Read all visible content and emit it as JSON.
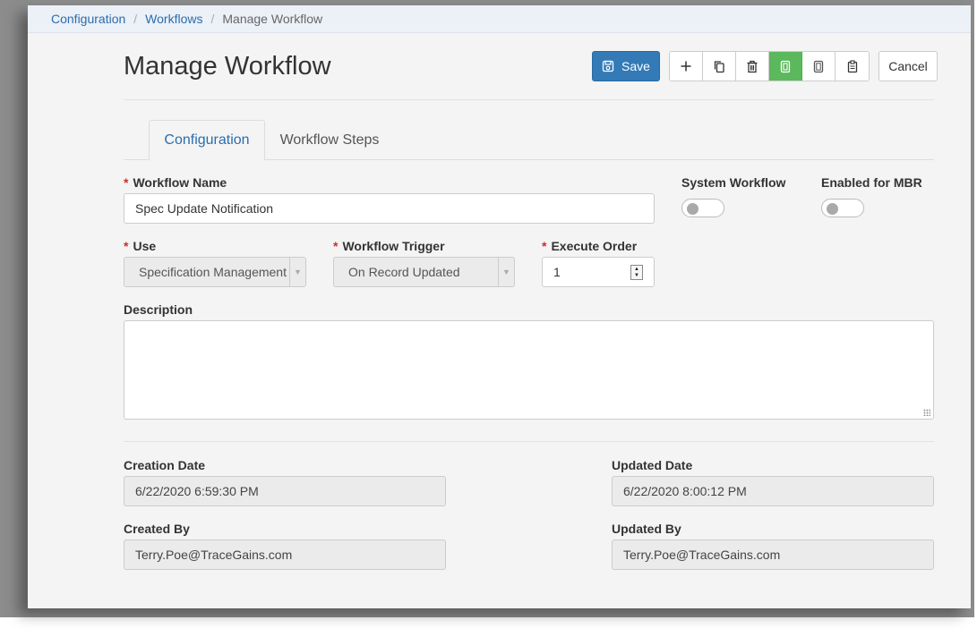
{
  "breadcrumb": {
    "items": [
      "Configuration",
      "Workflows"
    ],
    "current": "Manage Workflow",
    "separator": "/"
  },
  "page": {
    "title": "Manage Workflow"
  },
  "toolbar": {
    "save_label": "Save",
    "cancel_label": "Cancel",
    "icons": [
      "plus-icon",
      "copy-icon",
      "trash-icon",
      "active-document-icon",
      "document-icon",
      "clipboard-icon"
    ],
    "accent_color": "#337ab7",
    "active_color": "#5cb85c"
  },
  "tabs": [
    {
      "label": "Configuration",
      "active": true
    },
    {
      "label": "Workflow Steps",
      "active": false
    }
  ],
  "form": {
    "required_marker": "*",
    "workflow_name": {
      "label": "Workflow Name",
      "value": "Spec Update Notification"
    },
    "system_workflow": {
      "label": "System Workflow",
      "on": false
    },
    "enabled_for_mbr": {
      "label": "Enabled for MBR",
      "on": false
    },
    "use": {
      "label": "Use",
      "value": "Specification Management"
    },
    "workflow_trigger": {
      "label": "Workflow Trigger",
      "value": "On Record Updated"
    },
    "execute_order": {
      "label": "Execute Order",
      "value": "1"
    },
    "description": {
      "label": "Description",
      "value": ""
    },
    "creation_date": {
      "label": "Creation Date",
      "value": "6/22/2020 6:59:30 PM"
    },
    "updated_date": {
      "label": "Updated Date",
      "value": "6/22/2020 8:00:12 PM"
    },
    "created_by": {
      "label": "Created By",
      "value": "Terry.Poe@TraceGains.com"
    },
    "updated_by": {
      "label": "Updated By",
      "value": "Terry.Poe@TraceGains.com"
    }
  }
}
